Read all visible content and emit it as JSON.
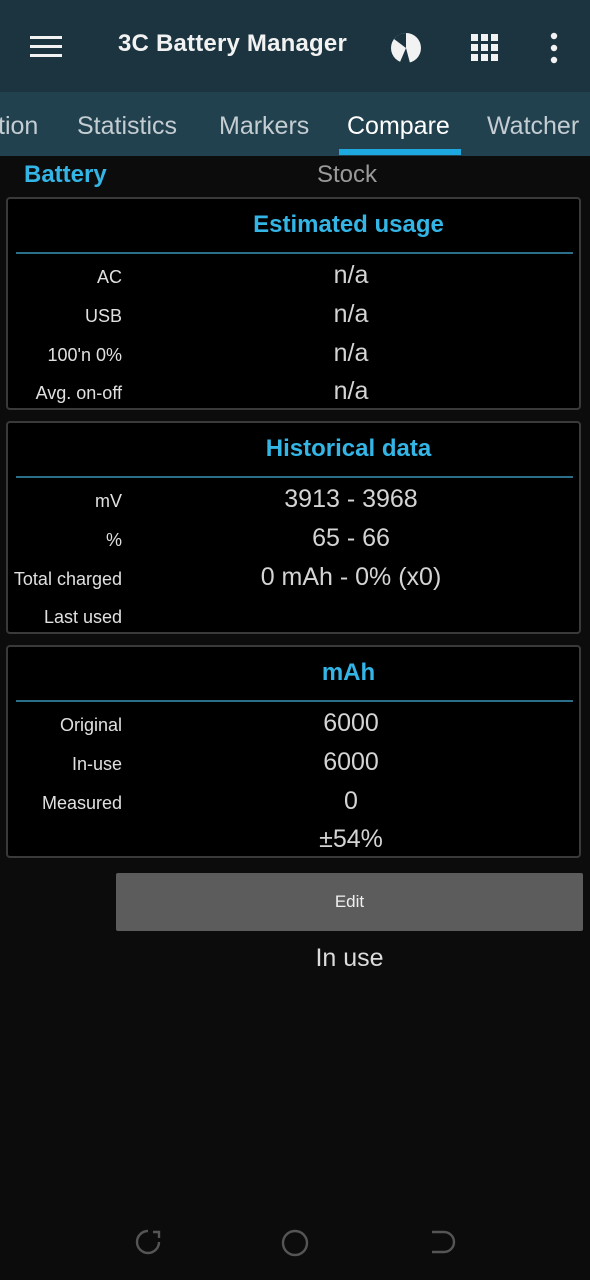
{
  "app_bar": {
    "title": "3C Battery Manager",
    "icons": [
      "menu-icon",
      "pie-chart-icon",
      "grid-icon",
      "more-vert-icon"
    ]
  },
  "tabs": [
    {
      "label": "tion",
      "active": false
    },
    {
      "label": "Statistics",
      "active": false
    },
    {
      "label": "Markers",
      "active": false
    },
    {
      "label": "Compare",
      "active": true
    },
    {
      "label": "Watcher",
      "active": false
    }
  ],
  "columns": {
    "left": "Battery",
    "right": "Stock"
  },
  "estimated_usage": {
    "title": "Estimated usage",
    "rows": [
      {
        "label": "AC",
        "value": "n/a"
      },
      {
        "label": "USB",
        "value": "n/a"
      },
      {
        "label": "100'n 0%",
        "value": "n/a"
      },
      {
        "label": "Avg. on-off",
        "value": "n/a"
      }
    ]
  },
  "historical_data": {
    "title": "Historical data",
    "rows": [
      {
        "label": "mV",
        "value": "3913 - 3968"
      },
      {
        "label": "%",
        "value": "65 - 66"
      },
      {
        "label": "Total charged",
        "value": "0 mAh - 0% (x0)"
      },
      {
        "label": "Last used",
        "value": ""
      }
    ]
  },
  "mah": {
    "title": "mAh",
    "rows": [
      {
        "label": "Original",
        "value": "6000"
      },
      {
        "label": "In-use",
        "value": "6000"
      },
      {
        "label": "Measured",
        "value": "0"
      },
      {
        "label": "",
        "value": "±54%"
      }
    ]
  },
  "edit_button": "Edit",
  "status_text": "In use",
  "colors": {
    "app_bar": "#1b3440",
    "tab_bar": "#22414f",
    "accent": "#33b5e5",
    "indicator": "#1ea8e0",
    "background": "#0c0c0c"
  }
}
